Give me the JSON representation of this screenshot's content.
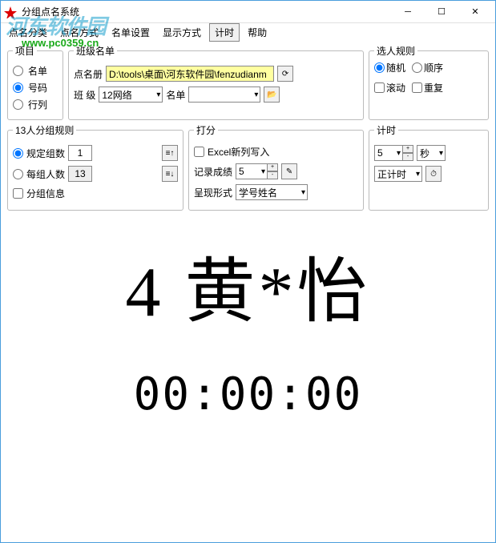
{
  "window": {
    "title": "分组点名系统"
  },
  "menu": [
    "点名分类",
    "点名方式",
    "名单设置",
    "显示方式",
    "计时",
    "帮助"
  ],
  "watermark": {
    "name": "河东软件园",
    "url": "www.pc0359.cn"
  },
  "project": {
    "legend": "项目",
    "opt_list": "名单",
    "opt_number": "号码",
    "opt_rowcol": "行列"
  },
  "classlist": {
    "legend": "班级名单",
    "label_file": "点名册",
    "file_value": "D:\\tools\\桌面\\河东软件园\\fenzudianm",
    "label_class": "班 级",
    "class_value": "12网络",
    "label_list": "名单",
    "list_value": ""
  },
  "selectrule": {
    "legend": "选人规则",
    "opt_random": "随机",
    "opt_order": "顺序",
    "opt_scroll": "滚动",
    "opt_repeat": "重复"
  },
  "grouprule": {
    "legend": "13人分组规则",
    "opt_groups": "规定组数",
    "groups_val": "1",
    "opt_per": "每组人数",
    "per_val": "13",
    "opt_info": "分组信息"
  },
  "score": {
    "legend": "打分",
    "opt_excel": "Excel新列写入",
    "label_record": "记录成绩",
    "record_val": "5",
    "label_show": "呈现形式",
    "show_val": "学号姓名"
  },
  "timer": {
    "legend": "计时",
    "val": "5",
    "unit": "秒",
    "mode": "正计时"
  },
  "display": "4 黄*怡",
  "timer_text": "00:00:00"
}
